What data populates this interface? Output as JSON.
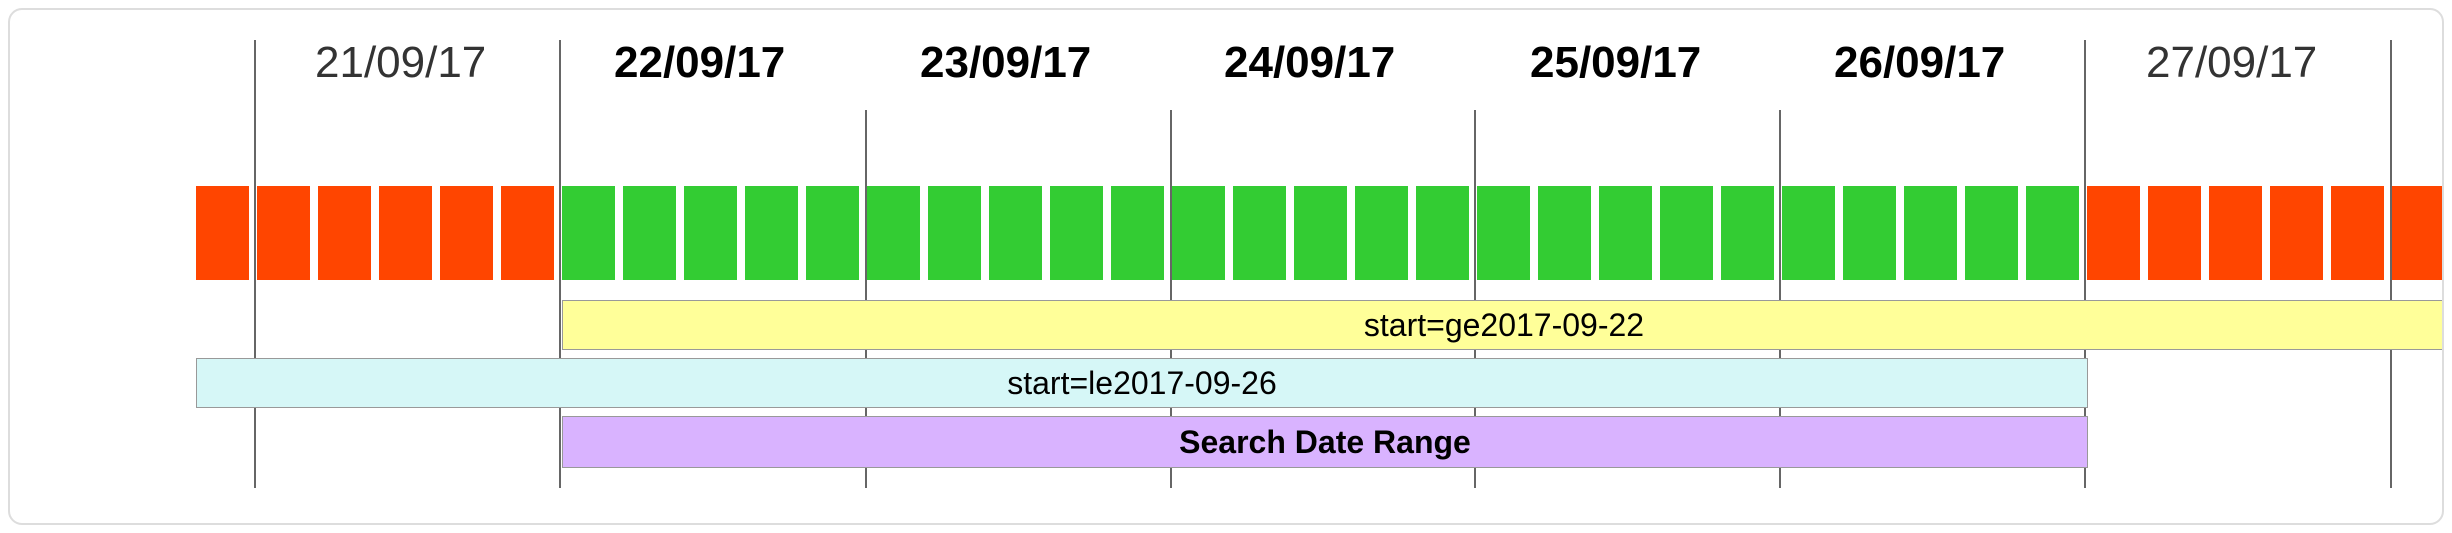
{
  "dates": [
    {
      "label": "21/09/17",
      "bold": false
    },
    {
      "label": "22/09/17",
      "bold": true
    },
    {
      "label": "23/09/17",
      "bold": true
    },
    {
      "label": "24/09/17",
      "bold": true
    },
    {
      "label": "25/09/17",
      "bold": true
    },
    {
      "label": "26/09/17",
      "bold": true
    },
    {
      "label": "27/09/17",
      "bold": false
    }
  ],
  "bars": {
    "ge": "start=ge2017-09-22",
    "le": "start=le2017-09-26",
    "range": "Search Date Range"
  },
  "chart_data": {
    "type": "timeline-range",
    "days": [
      "2017-09-21",
      "2017-09-22",
      "2017-09-23",
      "2017-09-24",
      "2017-09-25",
      "2017-09-26",
      "2017-09-27"
    ],
    "in_range_days": [
      "2017-09-22",
      "2017-09-23",
      "2017-09-24",
      "2017-09-25",
      "2017-09-26"
    ],
    "query_ge": "start=ge2017-09-22",
    "query_le": "start=le2017-09-26",
    "range_label": "Search Date Range",
    "blocks_per_day": 5,
    "colors": {
      "in_range": "#33cc33",
      "out_of_range": "#ff4500"
    }
  }
}
